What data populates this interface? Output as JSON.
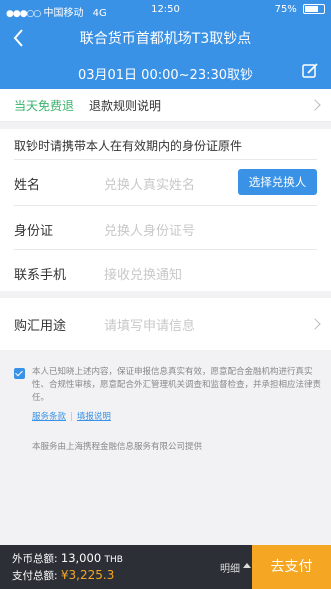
{
  "status_bar": {
    "carrier": "中国移动",
    "network": "4G",
    "time": "12:50",
    "battery": "75%"
  },
  "nav": {
    "back_icon": "back-arrow-icon",
    "title": "联合货币首都机场T3取钞点"
  },
  "subheader": {
    "time_slot": "03月01日 00:00~23:30取钞",
    "edit_icon": "edit-icon"
  },
  "notice": {
    "free_label": "当天免费退",
    "refund_rules": "退款规则说明"
  },
  "form": {
    "hint": "取钞时请携带本人在有效期内的身份证原件",
    "name_label": "姓名",
    "name_placeholder": "兑换人真实姓名",
    "choose_button": "选择兑换人",
    "id_label": "身份证",
    "id_placeholder": "兑换人身份证号",
    "phone_label": "联系手机",
    "phone_placeholder": "接收兑换通知",
    "purpose_label": "购汇用途",
    "purpose_placeholder": "请填写申请信息"
  },
  "agreement": {
    "checked": true,
    "text": "本人已知晓上述内容，保证申报信息真实有效，愿意配合金融机构进行真实性、合规性审核，愿意配合外汇管理机关调查和监督检查，并承担相应法律责任。",
    "terms_link": "服务条款",
    "guide_link": "填报说明"
  },
  "provider_note": "本服务由上海携程金融信息服务有限公司提供",
  "footer": {
    "foreign_label": "外币总额:",
    "foreign_amount": "13,000",
    "foreign_unit": "THB",
    "pay_label": "支付总额:",
    "pay_amount": "¥3,225.3",
    "detail": "明细",
    "pay_button": "去支付"
  },
  "colors": {
    "brand_blue": "#3a92e6",
    "free_green": "#3bb36d",
    "pay_orange": "#f5a623",
    "footer_dark": "#2c2f36"
  }
}
